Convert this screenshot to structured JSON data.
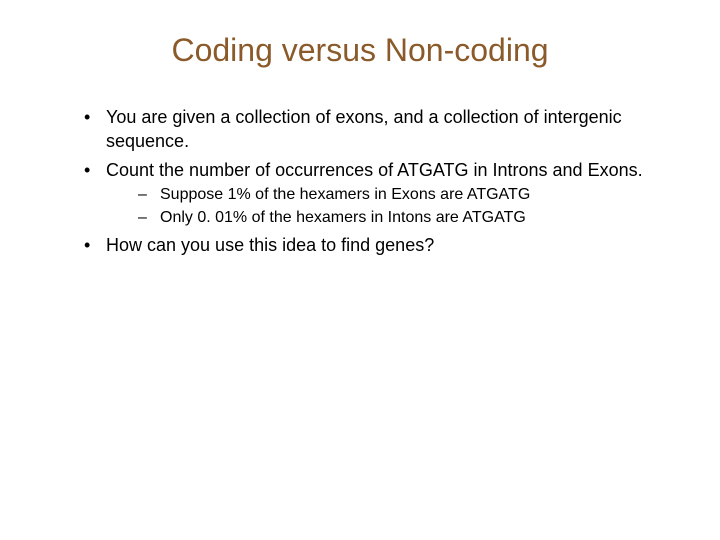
{
  "title": "Coding versus Non-coding",
  "bullets": {
    "b1": "You are given a collection of exons, and a collection of intergenic sequence.",
    "b2": "Count the number of occurrences of ATGATG in Introns and Exons.",
    "b2_sub": {
      "s1": "Suppose 1% of the hexamers in Exons are ATGATG",
      "s2": "Only 0. 01% of the hexamers in Intons are ATGATG"
    },
    "b3": "How can you use this idea to find genes?"
  }
}
